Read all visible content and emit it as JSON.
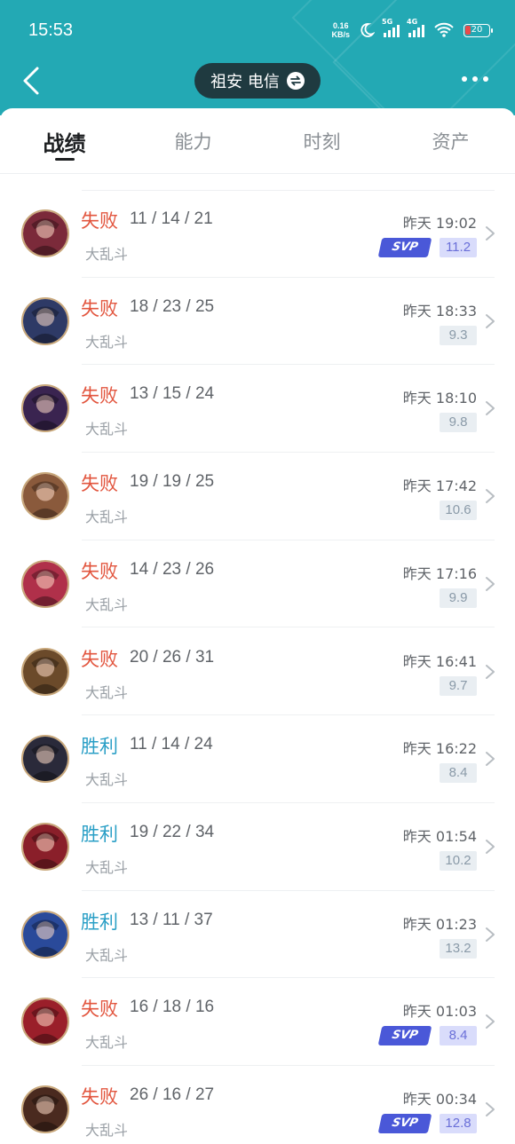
{
  "status_bar": {
    "time": "15:53",
    "net_speed_value": "0.16",
    "net_speed_unit": "KB/s",
    "sig1_label": "5G",
    "sig2_label": "4G",
    "battery": "20"
  },
  "header": {
    "server": "祖安 电信"
  },
  "tabs": [
    "战绩",
    "能力",
    "时刻",
    "资产"
  ],
  "matches": [
    {
      "result": "失败",
      "kda": "11 / 14 / 21",
      "mode": "大乱斗",
      "time": "昨天 19:02",
      "score": "11.2",
      "badge": "SVP",
      "avatar_color": "#7b2a3a"
    },
    {
      "result": "失败",
      "kda": "18 / 23 / 25",
      "mode": "大乱斗",
      "time": "昨天 18:33",
      "score": "9.3",
      "badge": "",
      "avatar_color": "#2e3a66"
    },
    {
      "result": "失败",
      "kda": "13 / 15 / 24",
      "mode": "大乱斗",
      "time": "昨天 18:10",
      "score": "9.8",
      "badge": "",
      "avatar_color": "#3a2450"
    },
    {
      "result": "失败",
      "kda": "19 / 19 / 25",
      "mode": "大乱斗",
      "time": "昨天 17:42",
      "score": "10.6",
      "badge": "",
      "avatar_color": "#8a5a3c"
    },
    {
      "result": "失败",
      "kda": "14 / 23 / 26",
      "mode": "大乱斗",
      "time": "昨天 17:16",
      "score": "9.9",
      "badge": "",
      "avatar_color": "#b0304a"
    },
    {
      "result": "失败",
      "kda": "20 / 26 / 31",
      "mode": "大乱斗",
      "time": "昨天 16:41",
      "score": "9.7",
      "badge": "",
      "avatar_color": "#6b4a2a"
    },
    {
      "result": "胜利",
      "kda": "11 / 14 / 24",
      "mode": "大乱斗",
      "time": "昨天 16:22",
      "score": "8.4",
      "badge": "",
      "avatar_color": "#2a2a3a"
    },
    {
      "result": "胜利",
      "kda": "19 / 22 / 34",
      "mode": "大乱斗",
      "time": "昨天 01:54",
      "score": "10.2",
      "badge": "",
      "avatar_color": "#8a1f2a"
    },
    {
      "result": "胜利",
      "kda": "13 / 11 / 37",
      "mode": "大乱斗",
      "time": "昨天 01:23",
      "score": "13.2",
      "badge": "",
      "avatar_color": "#2a4a9a"
    },
    {
      "result": "失败",
      "kda": "16 / 18 / 16",
      "mode": "大乱斗",
      "time": "昨天 01:03",
      "score": "8.4",
      "badge": "SVP",
      "avatar_color": "#9a1f2a"
    },
    {
      "result": "失败",
      "kda": "26 / 16 / 27",
      "mode": "大乱斗",
      "time": "昨天 00:34",
      "score": "12.8",
      "badge": "SVP",
      "avatar_color": "#4a2a1f"
    }
  ],
  "colors": {
    "header_bg": "#23a9b4",
    "lose": "#e2553e",
    "win": "#2a9fc6"
  }
}
